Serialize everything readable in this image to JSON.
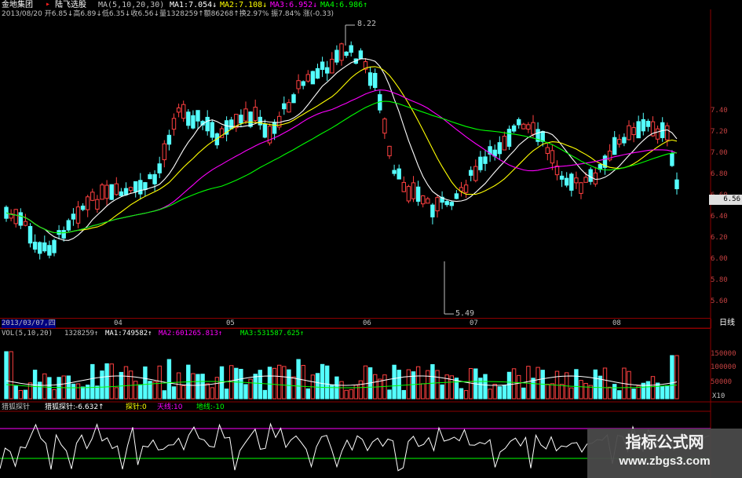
{
  "app": {
    "name": "金地集团",
    "stock": "陆飞选股"
  },
  "header": {
    "ma_title": "MA(5,10,20,30)",
    "ma1": "MA1:7.054↓",
    "ma2": "MA2:7.108↓",
    "ma3": "MA3:6.952↓",
    "ma4": "MA4:6.986↑",
    "info_line": "2013/08/20 开6.85↓高6.89↓低6.35↓收6.56↓量1328259↑额86268↑换2.97% 振7.84% 涨(-0.33)",
    "colors": {
      "ma1": "#ffffff",
      "ma2": "#ffff00",
      "ma3": "#ff00ff",
      "ma4": "#00ff00"
    }
  },
  "price_axis": {
    "labels": [
      "7.40",
      "7.20",
      "7.00",
      "6.80",
      "6.60",
      "6.40",
      "6.20",
      "6.00",
      "5.80",
      "5.60"
    ],
    "current": "6.56"
  },
  "annotations": {
    "high": "8.22",
    "low": "5.49"
  },
  "date_axis": {
    "start": "2013/03/07,四",
    "ticks": [
      "04",
      "05",
      "06",
      "07",
      "08"
    ],
    "period": "日线"
  },
  "volume_panel": {
    "title": "VOL(5,10,20)",
    "vol": "1328259↑",
    "ma1": "MA1:749582↑",
    "ma2": "MA2:601265.813↑",
    "ma3": "MA3:531587.625↑",
    "axis": [
      "150000",
      "100000",
      "50000"
    ],
    "unit": "X10"
  },
  "indicator_panel": {
    "title": "猎狐探针",
    "value": "猎狐探针:-6.632↑",
    "probe": "探针:0",
    "sky": "天线:10",
    "ground": "地线:-10"
  },
  "watermark": {
    "title": "指标公式网",
    "url": "www.zbgs3.com"
  },
  "colors": {
    "up": "#ff4040",
    "down": "#54ffff",
    "axis": "#8b0000",
    "background": "#000000"
  }
}
